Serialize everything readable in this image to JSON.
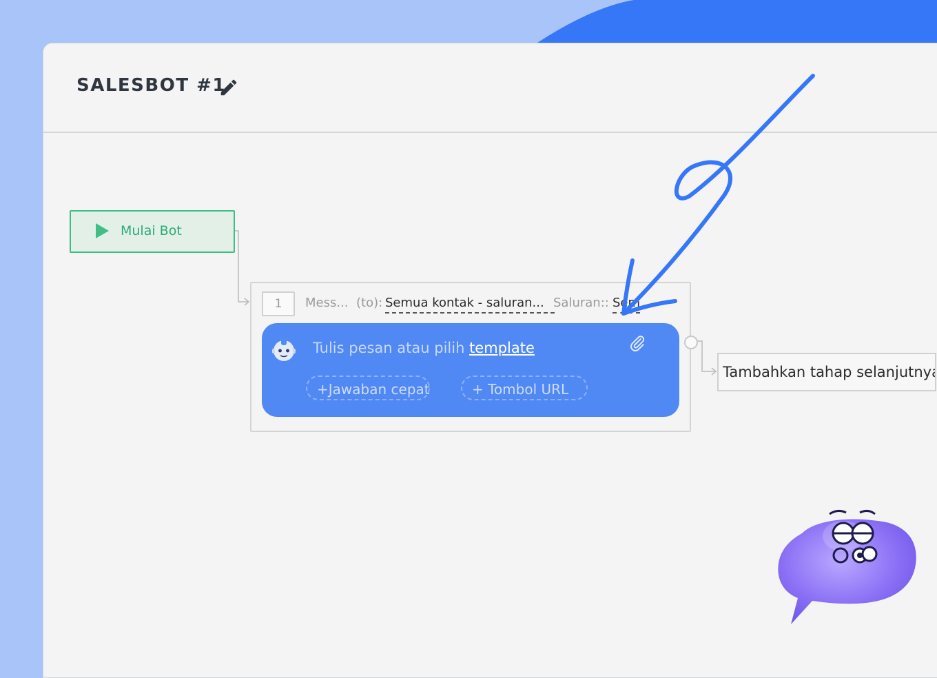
{
  "header": {
    "title": "SALESBOT #1",
    "edit_icon": "pencil-icon"
  },
  "start_node": {
    "label": "Mulai Bot",
    "icon": "play-icon",
    "color": "#3fbe86"
  },
  "step": {
    "number": "1",
    "type_label": "Mess...",
    "to_label": "(to):",
    "to_value": "Semua kontak - saluran...",
    "channel_label": "Saluran::",
    "channel_value": "Semua",
    "message": {
      "placeholder": "Tulis pesan atau pilih",
      "template_link": "template",
      "attach_icon": "paperclip-icon",
      "avatar_icon": "bot-avatar-icon",
      "quick_reply": "Jawaban cepat",
      "url_button": "Tombol URL",
      "bubble_color": "#5189f4"
    }
  },
  "next_step": {
    "label": "Tambahkan tahap selanjutnya"
  },
  "colors": {
    "background": "#a8c4f8",
    "accent_blue": "#3577f7",
    "canvas": "#f4f4f4"
  }
}
